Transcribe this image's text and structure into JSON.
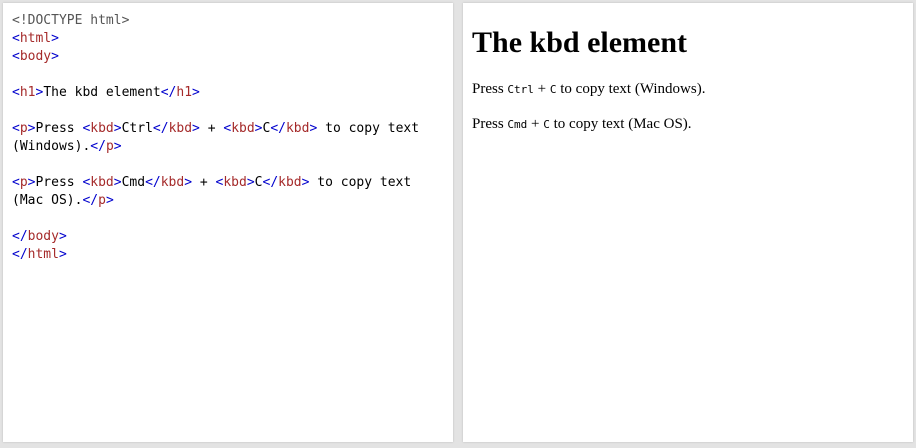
{
  "editor": {
    "doctype": "<!DOCTYPE html>",
    "html_tag": "html",
    "body_tag": "body",
    "h1_tag": "h1",
    "p_tag": "p",
    "kbd_tag": "kbd",
    "h1_text": "The kbd element",
    "p1_prefix": "Press ",
    "p1_key1": "Ctrl",
    "p1_plus": " + ",
    "p1_key2": "C",
    "p1_suffix": " to copy text (Windows).",
    "p2_prefix": "Press ",
    "p2_key1": "Cmd",
    "p2_plus": " + ",
    "p2_key2": "C",
    "p2_suffix": " to copy text (Mac OS)."
  },
  "result": {
    "heading": "The kbd element",
    "p1": {
      "prefix": "Press ",
      "key1": "Ctrl",
      "plus": " + ",
      "key2": "C",
      "suffix": " to copy text (Windows)."
    },
    "p2": {
      "prefix": "Press ",
      "key1": "Cmd",
      "plus": " + ",
      "key2": "C",
      "suffix": " to copy text (Mac OS)."
    }
  }
}
